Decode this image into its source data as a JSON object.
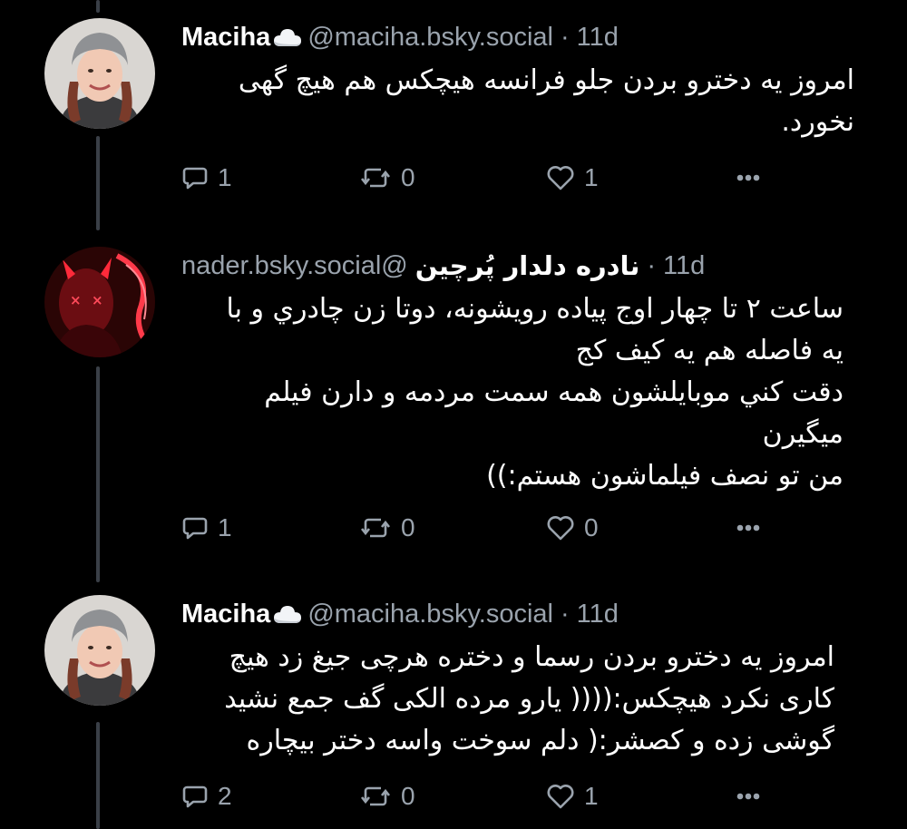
{
  "posts": [
    {
      "name": "Maciha",
      "handle": "@maciha.bsky.social",
      "separator": "·",
      "time": "11d",
      "lines": [
        "امروز یه دخترو بردن جلو فرانسه هیچکس هم هیچ گهی",
        "نخورد."
      ],
      "replies": "1",
      "reposts": "0",
      "likes": "1"
    },
    {
      "name": "نادره دلدار پُرچین",
      "handle": "nader.bsky.social@",
      "separator": "·",
      "time": "11d",
      "lines": [
        "ساعت ۲ تا چهار اوج پیاده رویشونه، دوتا زن چادري و با",
        "یه فاصله هم یه کیف کج",
        "دقت کني موبایلشون همه سمت مردمه و دارن فیلم",
        "میگیرن",
        "من تو نصف فیلماشون هستم:))"
      ],
      "replies": "1",
      "reposts": "0",
      "likes": "0"
    },
    {
      "name": "Maciha",
      "handle": "@maciha.bsky.social",
      "separator": "·",
      "time": "11d",
      "lines": [
        "امروز یه دخترو بردن رسما و دختره هرچی جیغ زد هیچ",
        "کاری نکرد هیچکس:(((( یارو مرده الکی گف جمع نشید",
        "گوشی زده و کصشر:( دلم سوخت واسه دختر بیچاره"
      ],
      "replies": "2",
      "reposts": "0",
      "likes": "1"
    }
  ],
  "colors": {
    "background": "#000000",
    "text": "#ffffff",
    "muted": "#9aa3ad",
    "thread_line": "#3a3f47"
  },
  "icons": {
    "reply": "speech-bubble-icon",
    "repost": "repost-icon",
    "like": "heart-icon",
    "more": "ellipsis-icon",
    "cloud": "cloud-emoji"
  }
}
